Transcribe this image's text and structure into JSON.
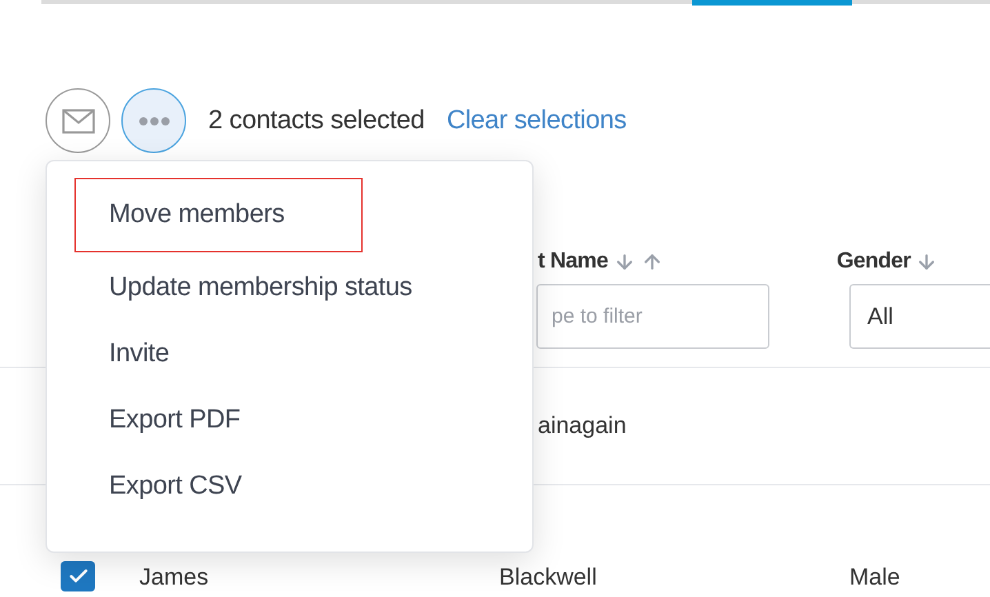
{
  "tabs": [
    {
      "selected": false
    },
    {
      "selected": true
    },
    {
      "selected": false
    }
  ],
  "toolbar": {
    "email_button": {
      "selected": false
    },
    "more_button": {
      "selected": true
    },
    "selection_count": "2 contacts selected",
    "clear_link": "Clear selections"
  },
  "menu": {
    "items": [
      {
        "label": "Move members",
        "highlighted": true
      },
      {
        "label": "Update membership status",
        "highlighted": false
      },
      {
        "label": "Invite",
        "highlighted": false
      },
      {
        "label": "Export PDF",
        "highlighted": false
      },
      {
        "label": "Export CSV",
        "highlighted": false
      }
    ]
  },
  "table": {
    "columns": [
      {
        "label": "t Name",
        "sort_down": true,
        "sort_up": true,
        "filter": {
          "kind": "text",
          "placeholder": "pe to filter"
        }
      },
      {
        "label": "Gender",
        "sort_down": true,
        "filter": {
          "kind": "select",
          "value": "All"
        }
      }
    ],
    "rows": [
      {
        "last_name": "ainagain"
      },
      {
        "checked": true,
        "first_name": "James",
        "last_name": "Blackwell",
        "gender": "Male"
      }
    ]
  }
}
